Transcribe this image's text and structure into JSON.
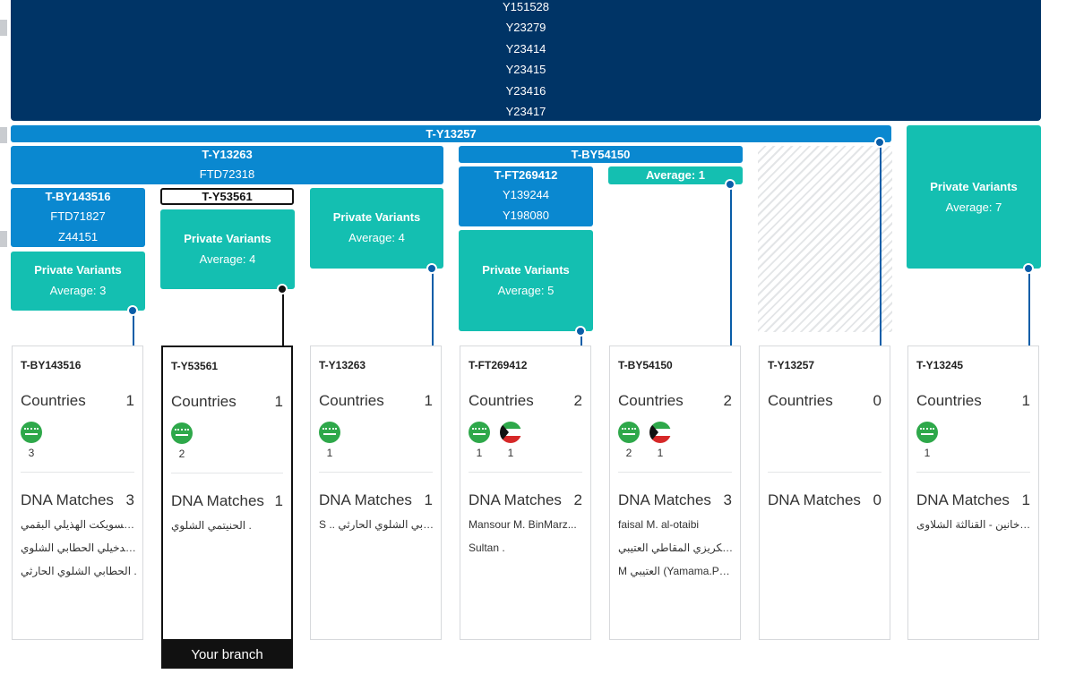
{
  "top_block": {
    "variants": [
      "Y151528",
      "Y23279",
      "Y23414",
      "Y23415",
      "Y23416",
      "Y23417"
    ]
  },
  "bars": {
    "y13257": "T-Y13257",
    "y13263": "T-Y13263",
    "y13263_sub": "FTD72318",
    "by54150": "T-BY54150"
  },
  "blocks": {
    "by143516": {
      "title": "T-BY143516",
      "lines": [
        "FTD71827",
        "Z44151"
      ]
    },
    "y53561": {
      "title": "T-Y53561"
    },
    "ft269412": {
      "title": "T-FT269412",
      "lines": [
        "Y139244",
        "Y198080"
      ]
    },
    "by54150_avg": "Average: 1"
  },
  "private": [
    {
      "id": "p1",
      "label": "Private Variants",
      "avg": "Average: 3"
    },
    {
      "id": "p2",
      "label": "Private Variants",
      "avg": "Average: 4"
    },
    {
      "id": "p3",
      "label": "Private Variants",
      "avg": "Average: 4"
    },
    {
      "id": "p4",
      "label": "Private Variants",
      "avg": "Average: 5"
    },
    {
      "id": "p5",
      "label": "Private Variants",
      "avg": "Average: 7"
    }
  ],
  "cards": [
    {
      "title": "T-BY143516",
      "countries_label": "Countries",
      "countries": "1",
      "flags": [
        {
          "icon": "saudi-arabia-flag-icon",
          "count": "3"
        }
      ],
      "dna_label": "DNA Matches",
      "dna": "3",
      "matches": [
        "السويكت الهذيلي البقمي A A...",
        "فهد الدخيلي الحطابي الشلوي ...",
        "الحطابي الشلوي الحارثي ."
      ]
    },
    {
      "title": "T-Y53561",
      "countries_label": "Countries",
      "countries": "1",
      "flags": [
        {
          "icon": "saudi-arabia-flag-icon",
          "count": "2"
        }
      ],
      "dna_label": "DNA Matches",
      "dna": "1",
      "matches": [
        "الحنيتمي الشلوي ."
      ]
    },
    {
      "title": "T-Y13263",
      "countries_label": "Countries",
      "countries": "1",
      "flags": [
        {
          "icon": "saudi-arabia-flag-icon",
          "count": "1"
        }
      ],
      "dna_label": "DNA Matches",
      "dna": "1",
      "matches": [
        "S .. لحطابي الشلوي الحارثي..."
      ]
    },
    {
      "title": "T-FT269412",
      "countries_label": "Countries",
      "countries": "2",
      "flags": [
        {
          "icon": "saudi-arabia-flag-icon",
          "count": "1"
        },
        {
          "icon": "kuwait-flag-icon",
          "count": "1"
        }
      ],
      "dna_label": "DNA Matches",
      "dna": "2",
      "matches": [
        "Mansour M. BinMarz...",
        "Sultan ."
      ]
    },
    {
      "title": "T-BY54150",
      "countries_label": "Countries",
      "countries": "2",
      "flags": [
        {
          "icon": "saudi-arabia-flag-icon",
          "count": "2"
        },
        {
          "icon": "kuwait-flag-icon",
          "count": "1"
        }
      ],
      "dna_label": "DNA Matches",
      "dna": "3",
      "matches": [
        "faisal M. al-otaibi",
        "رق الكريزي المقاطي العتيبي...",
        "M العتيبي (Yamama.P&..."
      ]
    },
    {
      "title": "T-Y13257",
      "countries_label": "Countries",
      "countries": "0",
      "flags": [],
      "dna_label": "DNA Matches",
      "dna": "0",
      "matches": []
    },
    {
      "title": "T-Y13245",
      "countries_label": "Countries",
      "countries": "1",
      "flags": [
        {
          "icon": "saudi-arabia-flag-icon",
          "count": "1"
        }
      ],
      "dna_label": "DNA Matches",
      "dna": "1",
      "matches": [
        "الدخانين - القنالثة الشلاوى .. ."
      ]
    }
  ],
  "your_branch_label": "Your branch",
  "colors": {
    "navy": "#003466",
    "blue": "#0a88d0",
    "teal": "#14bfb1",
    "connector": "#0a5ea8"
  }
}
